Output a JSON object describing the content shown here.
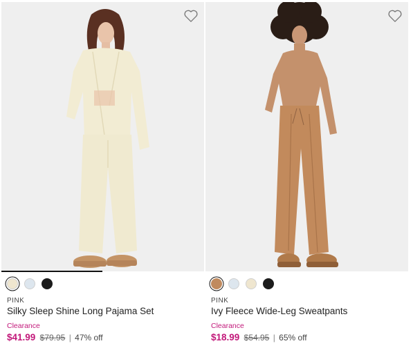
{
  "products": [
    {
      "brand": "PINK",
      "name": "Silky Sleep Shine Long Pajama Set",
      "flag": "Clearance",
      "sale_price": "$41.99",
      "original_price": "$79.95",
      "separator": "|",
      "discount": "47% off",
      "swatches": [
        "#efe6cf",
        "#dde6ee",
        "#1c1c1c"
      ],
      "selected_swatch": 0,
      "favorite_icon": "heart-outline-icon"
    },
    {
      "brand": "PINK",
      "name": "Ivy Fleece Wide-Leg Sweatpants",
      "flag": "Clearance",
      "sale_price": "$18.99",
      "original_price": "$54.95",
      "separator": "|",
      "discount": "65% off",
      "swatches": [
        "#c08a5e",
        "#dde6ee",
        "#efe6cf",
        "#1c1c1c"
      ],
      "selected_swatch": 0,
      "favorite_icon": "heart-outline-icon"
    }
  ],
  "colors": {
    "accent": "#c2187a",
    "card_bg": "#efefef"
  }
}
